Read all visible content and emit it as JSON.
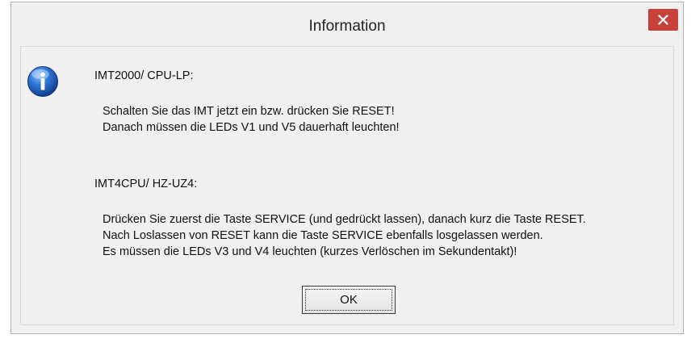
{
  "dialog": {
    "title": "Information",
    "section1": {
      "heading": "IMT2000/ CPU-LP:",
      "lines": [
        "Schalten Sie das IMT jetzt ein bzw. drücken Sie RESET!",
        "Danach müssen die LEDs V1 und V5 dauerhaft leuchten!"
      ]
    },
    "section2": {
      "heading": "IMT4CPU/ HZ-UZ4:",
      "lines": [
        "Drücken Sie zuerst die Taste SERVICE (und gedrückt lassen), danach kurz die Taste RESET.",
        "Nach Loslassen von RESET kann die Taste SERVICE ebenfalls losgelassen werden.",
        "Es müssen die LEDs V3 und V4 leuchten (kurzes Verlöschen im Sekundentakt)!"
      ]
    },
    "ok_label": "OK",
    "icon": "information-icon",
    "close_icon": "close-icon",
    "colors": {
      "close_button": "#c7423b",
      "icon_blue": "#1f5fbf",
      "background": "#f0f0f0"
    }
  }
}
